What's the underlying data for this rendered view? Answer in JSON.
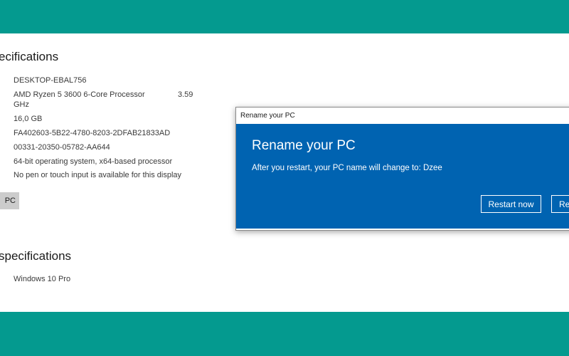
{
  "device_specifications": {
    "heading": "ecifications",
    "device_name": "DESKTOP-EBAL756",
    "processor_line1": "AMD Ryzen 5 3600 6-Core Processor",
    "processor_speed": "3.59",
    "processor_line2": "GHz",
    "installed_ram": "16,0 GB",
    "device_id": "FA402603-5B22-4780-8203-2DFAB21833AD",
    "product_id": "00331-20350-05782-AA644",
    "system_type": "64-bit operating system, x64-based processor",
    "pen_and_touch": "No pen or touch input is available for this display",
    "rename_button_label": "PC"
  },
  "windows_specifications": {
    "heading": "specifications",
    "edition": "Windows 10 Pro"
  },
  "dialog": {
    "title": "Rename your PC",
    "heading": "Rename your PC",
    "message": "After you restart, your PC name will change to: Dzee",
    "restart_now_label": "Restart now",
    "restart_later_label": "Re"
  },
  "colors": {
    "background_teal": "#049a8f",
    "dialog_blue": "#0063b1",
    "button_gray": "#cccccc"
  }
}
